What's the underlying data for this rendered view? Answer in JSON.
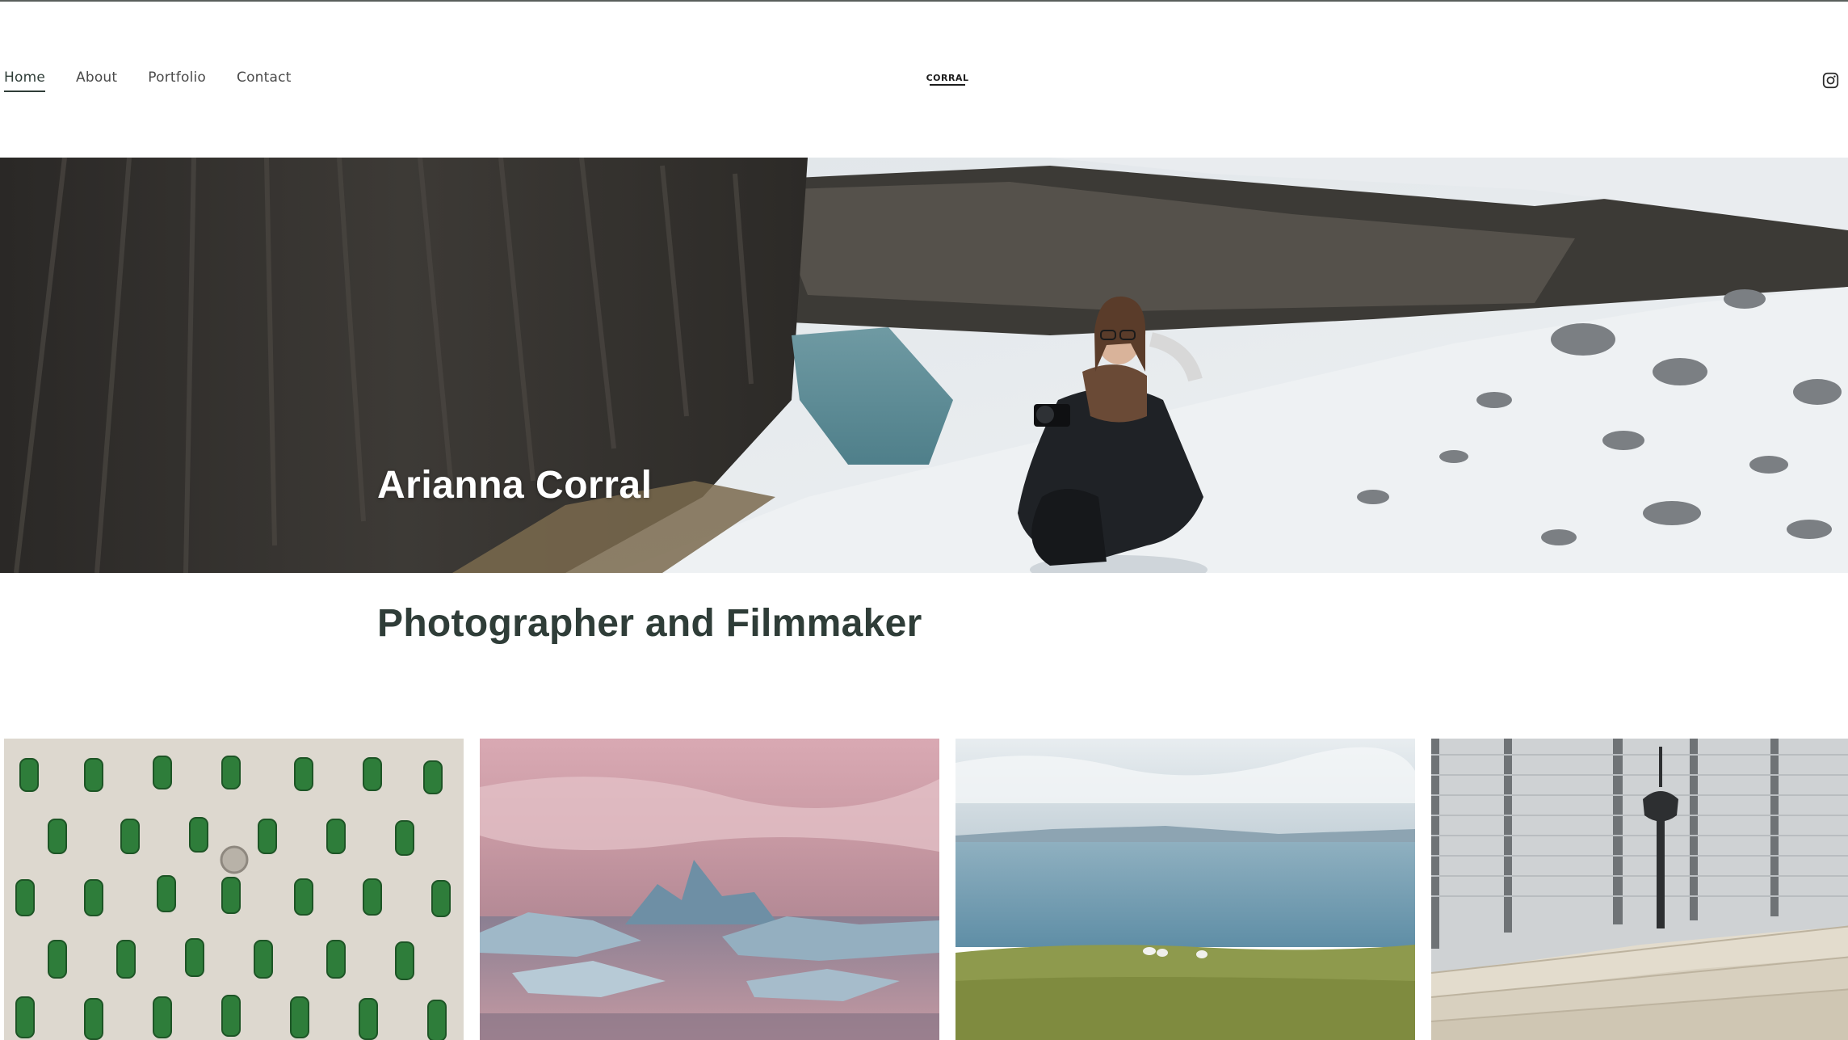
{
  "nav": {
    "items": [
      {
        "label": "Home",
        "active": true
      },
      {
        "label": "About",
        "active": false
      },
      {
        "label": "Portfolio",
        "active": false
      },
      {
        "label": "Contact",
        "active": false
      }
    ]
  },
  "logo": {
    "text": "CORRAL"
  },
  "social": {
    "icon": "instagram-icon"
  },
  "hero": {
    "title": "Arianna Corral"
  },
  "intro": {
    "subtitle": "Photographer and Filmmaker"
  },
  "gallery": {
    "tiles": [
      {
        "icon": "green-bottles-photo"
      },
      {
        "icon": "pink-sky-icebergs-photo"
      },
      {
        "icon": "sea-coast-sheep-photo"
      },
      {
        "icon": "tower-and-steps-photo"
      }
    ]
  },
  "colors": {
    "text": "#2f3d38",
    "nav_text": "#4a4a4a",
    "background": "#ffffff"
  }
}
